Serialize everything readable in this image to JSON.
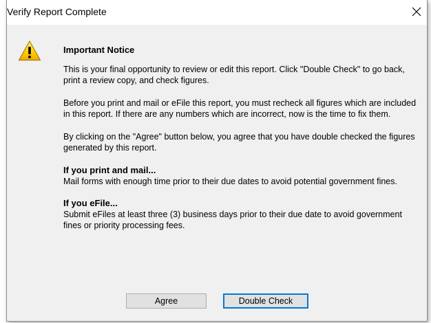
{
  "window": {
    "title": "Verify Report Complete",
    "close_glyph": "✕"
  },
  "notice": {
    "icon": "warning-icon",
    "heading": "Important Notice",
    "paragraph_1": "This is your final opportunity to review or edit this report. Click \"Double Check\" to go back, print a review copy, and check figures.",
    "paragraph_2": "Before you print and mail or eFile this report, you must recheck all figures which are included in this report.  If there are any numbers which are incorrect, now is the time to fix them.",
    "paragraph_3": "By clicking on the \"Agree\" button below, you agree that you have double checked the figures generated by this report.",
    "print_mail_heading": "If you print and mail...",
    "print_mail_text": "Mail forms with enough time prior to their due dates to avoid potential government fines.",
    "efile_heading": "If you eFile...",
    "efile_text": "Submit eFiles at least three (3) business days prior to their due date to avoid government fines or priority processing fees."
  },
  "buttons": {
    "agree_label": "Agree",
    "double_check_label": "Double Check"
  },
  "colors": {
    "focus_border": "#0078d7",
    "client_background": "#f0f0f0",
    "warning_yellow": "#ffcc00"
  }
}
